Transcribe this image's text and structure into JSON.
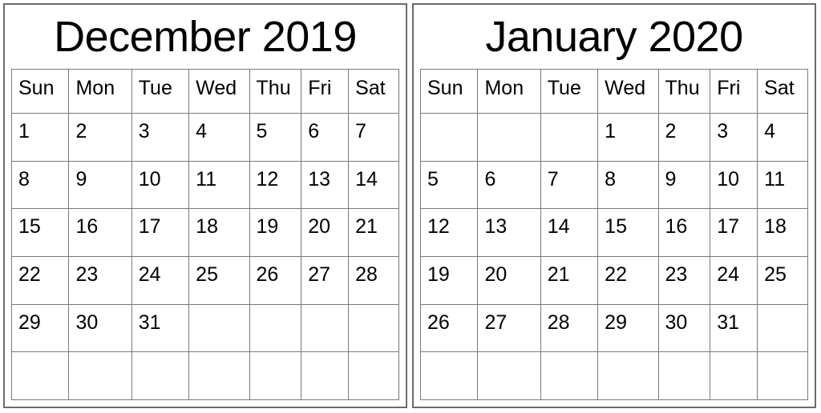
{
  "calendars": [
    {
      "title": "December 2019",
      "month": "December",
      "year": "2019",
      "weekdays": [
        "Sun",
        "Mon",
        "Tue",
        "Wed",
        "Thu",
        "Fri",
        "Sat"
      ],
      "weeks": [
        [
          "1",
          "2",
          "3",
          "4",
          "5",
          "6",
          "7"
        ],
        [
          "8",
          "9",
          "10",
          "11",
          "12",
          "13",
          "14"
        ],
        [
          "15",
          "16",
          "17",
          "18",
          "19",
          "20",
          "21"
        ],
        [
          "22",
          "23",
          "24",
          "25",
          "26",
          "27",
          "28"
        ],
        [
          "29",
          "30",
          "31",
          "",
          "",
          "",
          ""
        ],
        [
          "",
          "",
          "",
          "",
          "",
          "",
          ""
        ]
      ]
    },
    {
      "title": "January 2020",
      "month": "January",
      "year": "2020",
      "weekdays": [
        "Sun",
        "Mon",
        "Tue",
        "Wed",
        "Thu",
        "Fri",
        "Sat"
      ],
      "weeks": [
        [
          "",
          "",
          "",
          "1",
          "2",
          "3",
          "4"
        ],
        [
          "5",
          "6",
          "7",
          "8",
          "9",
          "10",
          "11"
        ],
        [
          "12",
          "13",
          "14",
          "15",
          "16",
          "17",
          "18"
        ],
        [
          "19",
          "20",
          "21",
          "22",
          "23",
          "24",
          "25"
        ],
        [
          "26",
          "27",
          "28",
          "29",
          "30",
          "31",
          ""
        ],
        [
          "",
          "",
          "",
          "",
          "",
          "",
          ""
        ]
      ]
    }
  ],
  "colors": {
    "outer_border": "#6b6b6b",
    "grid_line": "#7a7a7a",
    "text": "#000000",
    "background": "#ffffff"
  }
}
